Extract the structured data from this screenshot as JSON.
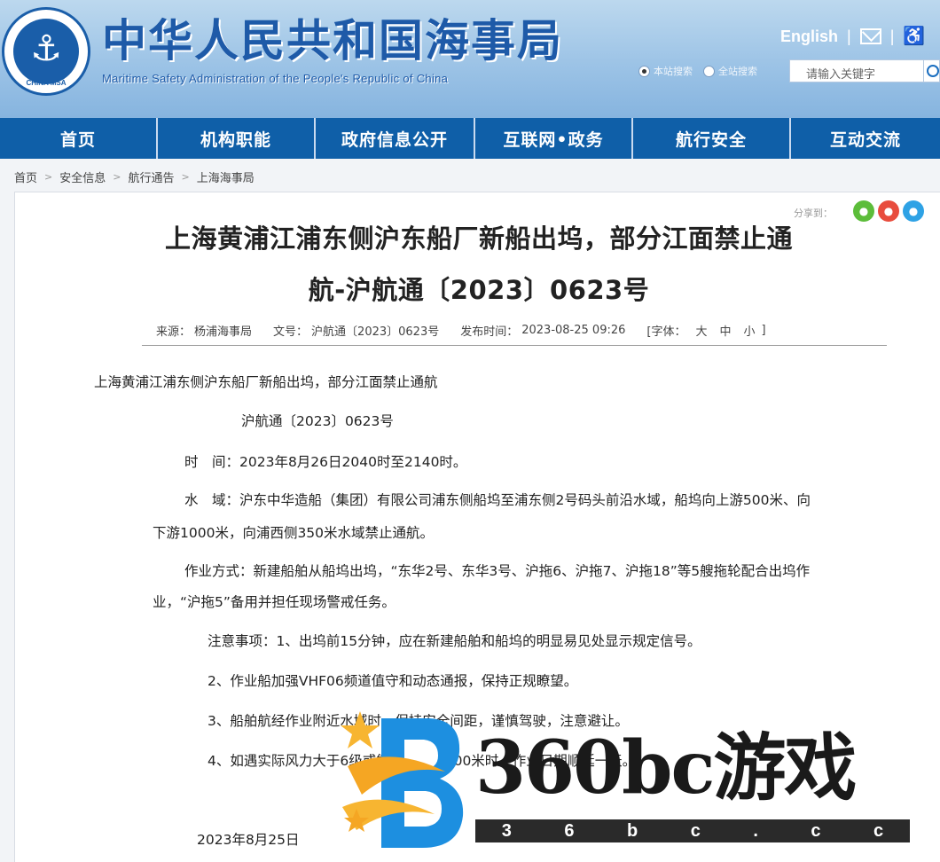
{
  "header": {
    "logo_text": "CHINA MSA",
    "title": "中华人民共和国海事局",
    "subtitle": "Maritime Safety Administration of the People's Republic of China",
    "english_link": "English",
    "sep": "|",
    "radio_1": "本站搜索",
    "radio_2": "全站搜索",
    "search_placeholder": "请输入关键字"
  },
  "nav": {
    "items": [
      "首页",
      "机构职能",
      "政府信息公开",
      "互联网•政务",
      "航行安全",
      "互动交流"
    ]
  },
  "breadcrumb": {
    "items": [
      "首页",
      "安全信息",
      "航行通告",
      "上海海事局"
    ],
    "arrow": ">"
  },
  "share": {
    "label": "分享到："
  },
  "article": {
    "title_line1": "上海黄浦江浦东侧沪东船厂新船出坞，部分江面禁止通",
    "title_line2": "航-沪航通〔2023〕0623号",
    "meta": {
      "source_label": "来源：",
      "source": "杨浦海事局",
      "doc_label": "文号：",
      "doc_no": "沪航通〔2023〕0623号",
      "time_label": "发布时间：",
      "time": "2023-08-25 09:26",
      "font_label": "[字体：",
      "font_large": "大",
      "font_mid": "中",
      "font_small": "小",
      "font_end": "]"
    },
    "para_title": "上海黄浦江浦东侧沪东船厂新船出坞，部分江面禁止通航",
    "para_docno": "沪航通〔2023〕0623号",
    "time_line": "时　间：2023年8月26日2040时至2140时。",
    "water_line1": "水　域：沪东中华造船（集团）有限公司浦东侧船坞至浦东侧2号码头前沿水域，船坞向上游500米、向",
    "water_line2": "下游1000米，向浦西侧350米水域禁止通航。",
    "work_line1": "作业方式：新建船舶从船坞出坞，“东华2号、东华3号、沪拖6、沪拖7、沪拖18”等5艘拖轮配合出坞作",
    "work_line2": "业，“沪拖5”备用并担任现场警戒任务。",
    "note_1": "注意事项：1、出坞前15分钟，应在新建船舶和船坞的明显易见处显示规定信号。",
    "note_2": "2、作业船加强VHF06频道值守和动态通报，保持正规瞭望。",
    "note_3": "3、船舶航经作业附近水域时，保持安全间距，谨慎驾驶，注意避让。",
    "note_4": "4、如遇实际风力大于6级或能见度小于500米时，作业日期顺延一天。",
    "date": "2023年8月25日"
  },
  "watermark": {
    "text": "360bc游戏",
    "url_chars": [
      "3",
      "6",
      "b",
      "c",
      ".",
      "c",
      "c"
    ]
  },
  "colors": {
    "header_blue": "#9cc3e6",
    "nav_blue": "#0f5fa8",
    "brand_blue": "#1e5aa8"
  }
}
